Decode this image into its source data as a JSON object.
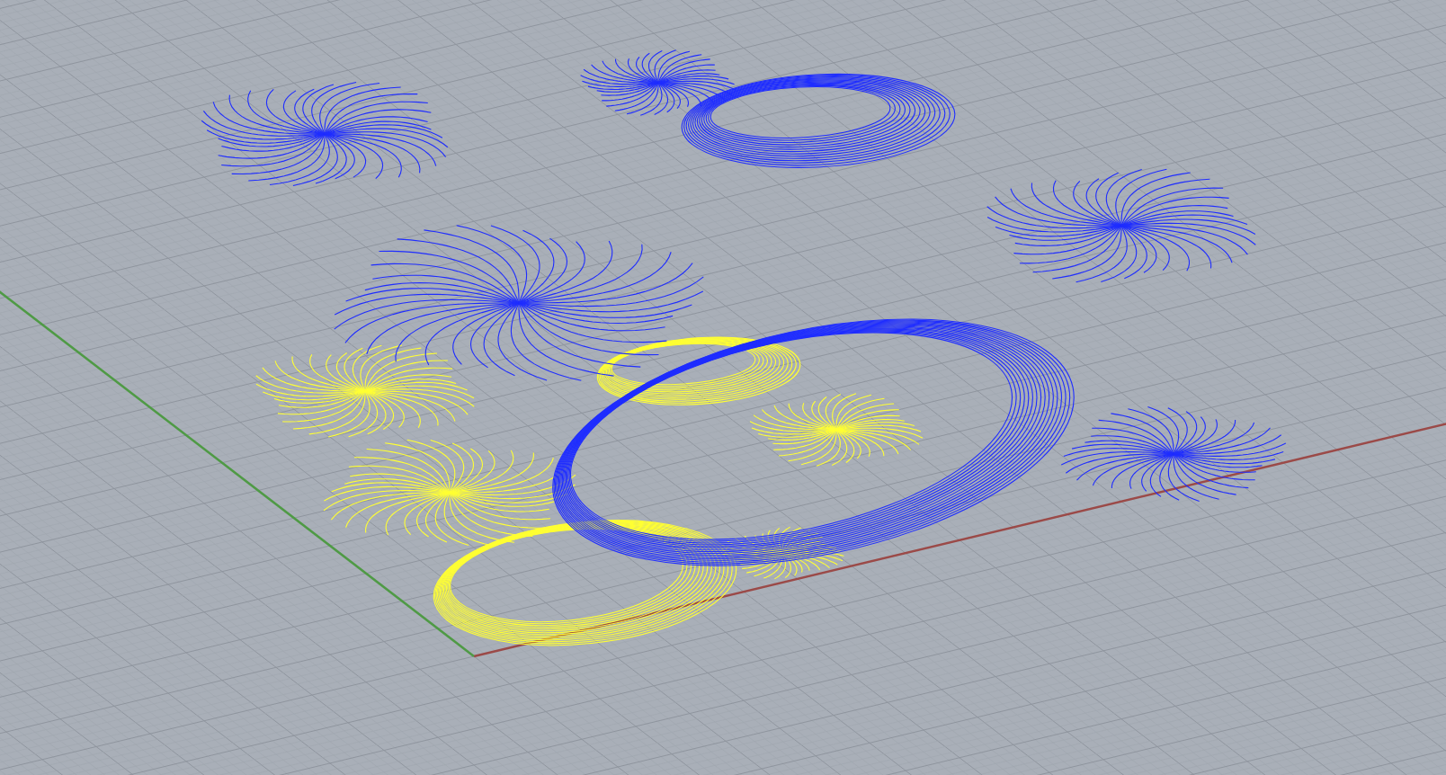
{
  "viewport": {
    "curve_sets": [
      {
        "kind": "field",
        "color": "#1f2dff"
      },
      {
        "kind": "field",
        "color": "#ffff33"
      }
    ]
  }
}
